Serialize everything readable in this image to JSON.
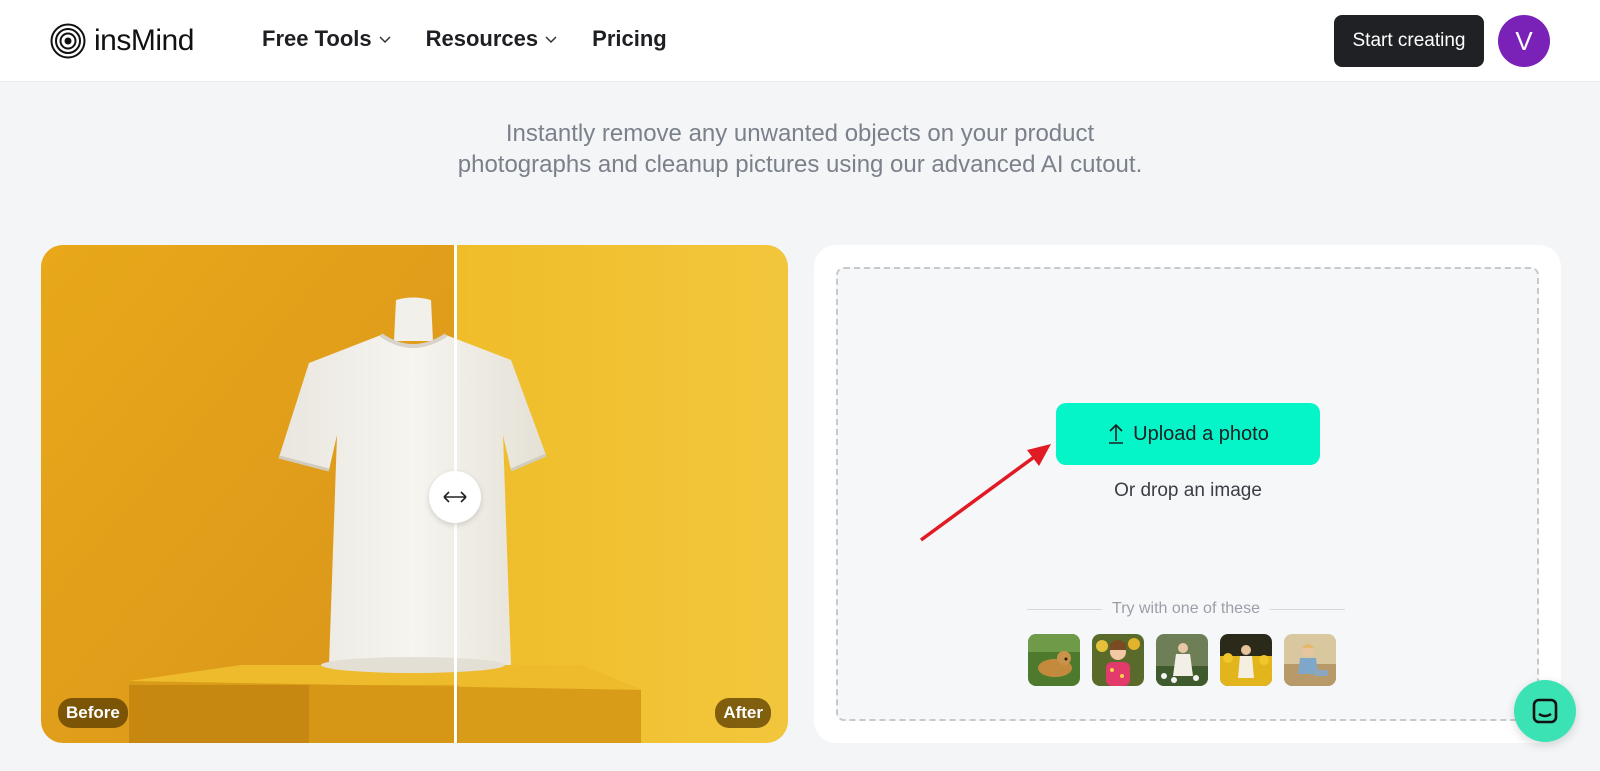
{
  "header": {
    "logo_text": "insMind",
    "nav": [
      {
        "label": "Free Tools",
        "has_dropdown": true
      },
      {
        "label": "Resources",
        "has_dropdown": true
      },
      {
        "label": "Pricing",
        "has_dropdown": false
      }
    ],
    "start_button": "Start creating",
    "avatar_initial": "V"
  },
  "hero": {
    "subtitle_line1": "Instantly remove any unwanted objects on your product",
    "subtitle_line2": "photographs and cleanup pictures using our advanced AI cutout."
  },
  "compare": {
    "before_label": "Before",
    "after_label": "After"
  },
  "upload": {
    "button_label": "Upload a photo",
    "drop_text": "Or drop an image",
    "try_label": "Try with one of these",
    "samples": [
      "dog-on-grass",
      "girl-with-flowers",
      "child-in-garden",
      "girl-in-yellow-field",
      "child-sitting"
    ]
  },
  "colors": {
    "accent": "#06f5c8",
    "avatar": "#7a22b8",
    "dark_button": "#1f2125",
    "chat": "#3be3b4",
    "arrow": "#e01b24"
  }
}
